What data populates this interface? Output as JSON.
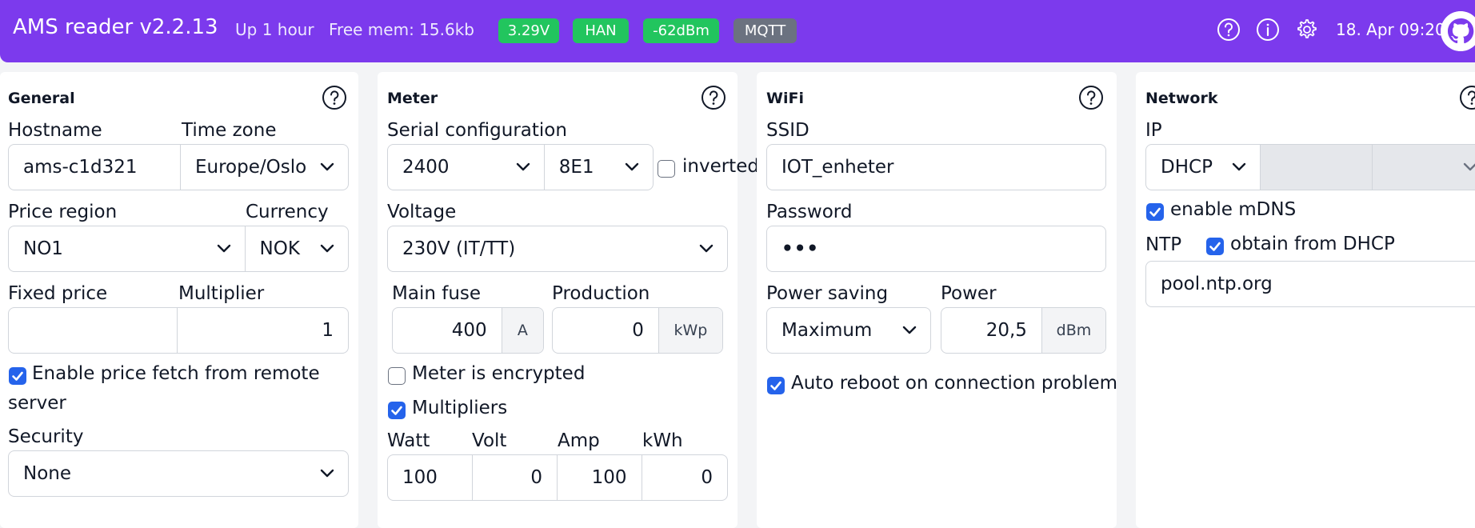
{
  "header": {
    "title": "AMS reader v2.2.13",
    "uptime": "Up 1 hour",
    "free_mem": "Free mem: 15.6kb",
    "badges": [
      {
        "label": "3.29V",
        "color": "#22c55e"
      },
      {
        "label": "HAN",
        "color": "#22c55e"
      },
      {
        "label": "-62dBm",
        "color": "#22c55e"
      },
      {
        "label": "MQTT",
        "color": "#6b7280"
      }
    ],
    "icons": [
      "help-circle-icon",
      "info-icon",
      "gear-icon",
      "github-icon"
    ],
    "datetime": "18. Apr 09:20"
  },
  "general": {
    "title": "General",
    "hostname_label": "Hostname",
    "hostname_value": "ams-c1d321",
    "timezone_label": "Time zone",
    "timezone_value": "Europe/Oslo",
    "price_region_label": "Price region",
    "price_region_value": "NO1",
    "currency_label": "Currency",
    "currency_value": "NOK",
    "fixed_price_label": "Fixed price",
    "fixed_price_value": "",
    "multiplier_label": "Multiplier",
    "multiplier_value": "1",
    "price_fetch_label_line1": "Enable price fetch from remote",
    "price_fetch_label_line2": "server",
    "price_fetch_checked": true,
    "security_label": "Security",
    "security_value": "None"
  },
  "meter": {
    "title": "Meter",
    "serial_label": "Serial configuration",
    "baud_value": "2400",
    "parity_value": "8E1",
    "inverted_label": "inverted",
    "inverted_checked": false,
    "voltage_label": "Voltage",
    "voltage_value": "230V (IT/TT)",
    "main_fuse_label": "Main fuse",
    "main_fuse_value": "400",
    "main_fuse_unit": "A",
    "production_label": "Production",
    "production_value": "0",
    "production_unit": "kWp",
    "encrypted_label": "Meter is encrypted",
    "encrypted_checked": false,
    "multipliers_label": "Multipliers",
    "multipliers_checked": true,
    "mult_headers": [
      "Watt",
      "Volt",
      "Amp",
      "kWh"
    ],
    "mult_values": [
      "100",
      "0",
      "100",
      "0"
    ]
  },
  "wifi": {
    "title": "WiFi",
    "ssid_label": "SSID",
    "ssid_value": "IOT_enheter",
    "password_label": "Password",
    "password_value": "•••",
    "power_saving_label": "Power saving",
    "power_saving_value": "Maximum",
    "power_label": "Power",
    "power_value": "20,5",
    "power_unit": "dBm",
    "auto_reboot_label": "Auto reboot on connection problem",
    "auto_reboot_checked": true
  },
  "network": {
    "title": "Network",
    "ip_label": "IP",
    "ip_mode_value": "DHCP",
    "mdns_label": "enable mDNS",
    "mdns_checked": true,
    "ntp_label": "NTP",
    "ntp_dhcp_label": "obtain from DHCP",
    "ntp_dhcp_checked": true,
    "ntp_server_value": "pool.ntp.org"
  }
}
